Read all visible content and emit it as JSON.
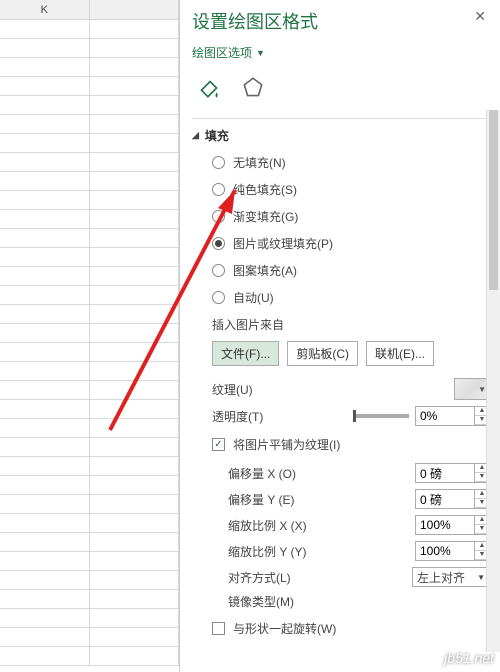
{
  "sheet": {
    "col": "K"
  },
  "pane": {
    "title": "设置绘图区格式",
    "dropdown": "绘图区选项",
    "section_fill": "填充",
    "radios": {
      "none": "无填充(N)",
      "solid": "纯色填充(S)",
      "gradient": "渐变填充(G)",
      "picture": "图片或纹理填充(P)",
      "pattern": "图案填充(A)",
      "auto": "自动(U)"
    },
    "insert_from": "插入图片来自",
    "buttons": {
      "file": "文件(F)...",
      "clip": "剪贴板(C)",
      "online": "联机(E)..."
    },
    "texture": "纹理(U)",
    "transparency": {
      "label": "透明度(T)",
      "value": "0%"
    },
    "tile": "将图片平铺为纹理(I)",
    "offset_x": {
      "label": "偏移量 X (O)",
      "value": "0 磅"
    },
    "offset_y": {
      "label": "偏移量 Y (E)",
      "value": "0 磅"
    },
    "scale_x": {
      "label": "缩放比例 X (X)",
      "value": "100%"
    },
    "scale_y": {
      "label": "缩放比例 Y (Y)",
      "value": "100%"
    },
    "align": {
      "label": "对齐方式(L)",
      "value": "左上对齐"
    },
    "mirror": "镜像类型(M)",
    "rotate": "与形状一起旋转(W)"
  },
  "watermark": "jb51.net"
}
